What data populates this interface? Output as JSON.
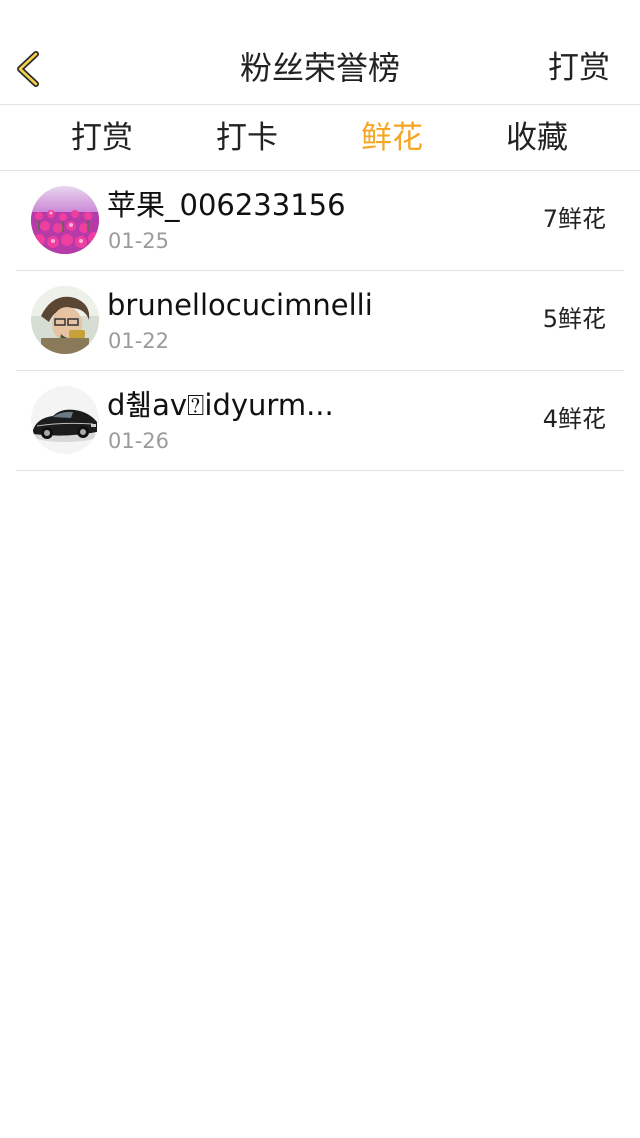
{
  "header": {
    "title": "粉丝荣誉榜",
    "back_icon": "chevron-left-icon",
    "right_action": "打赏",
    "accent_color": "#f5a623"
  },
  "tabs": [
    {
      "label": "打赏",
      "active": false
    },
    {
      "label": "打卡",
      "active": false
    },
    {
      "label": "鲜花",
      "active": true
    },
    {
      "label": "收藏",
      "active": false
    }
  ],
  "list": [
    {
      "name": "苹果_006233156",
      "date": "01-25",
      "count": "7鲜花",
      "avatar": "flowers-avatar"
    },
    {
      "name": "brunellocucimnelli",
      "date": "01-22",
      "count": "5鲜花",
      "avatar": "person-avatar"
    },
    {
      "name": "d췖av⍰idyurm...",
      "date": "01-26",
      "count": "4鲜花",
      "avatar": "car-avatar"
    }
  ]
}
